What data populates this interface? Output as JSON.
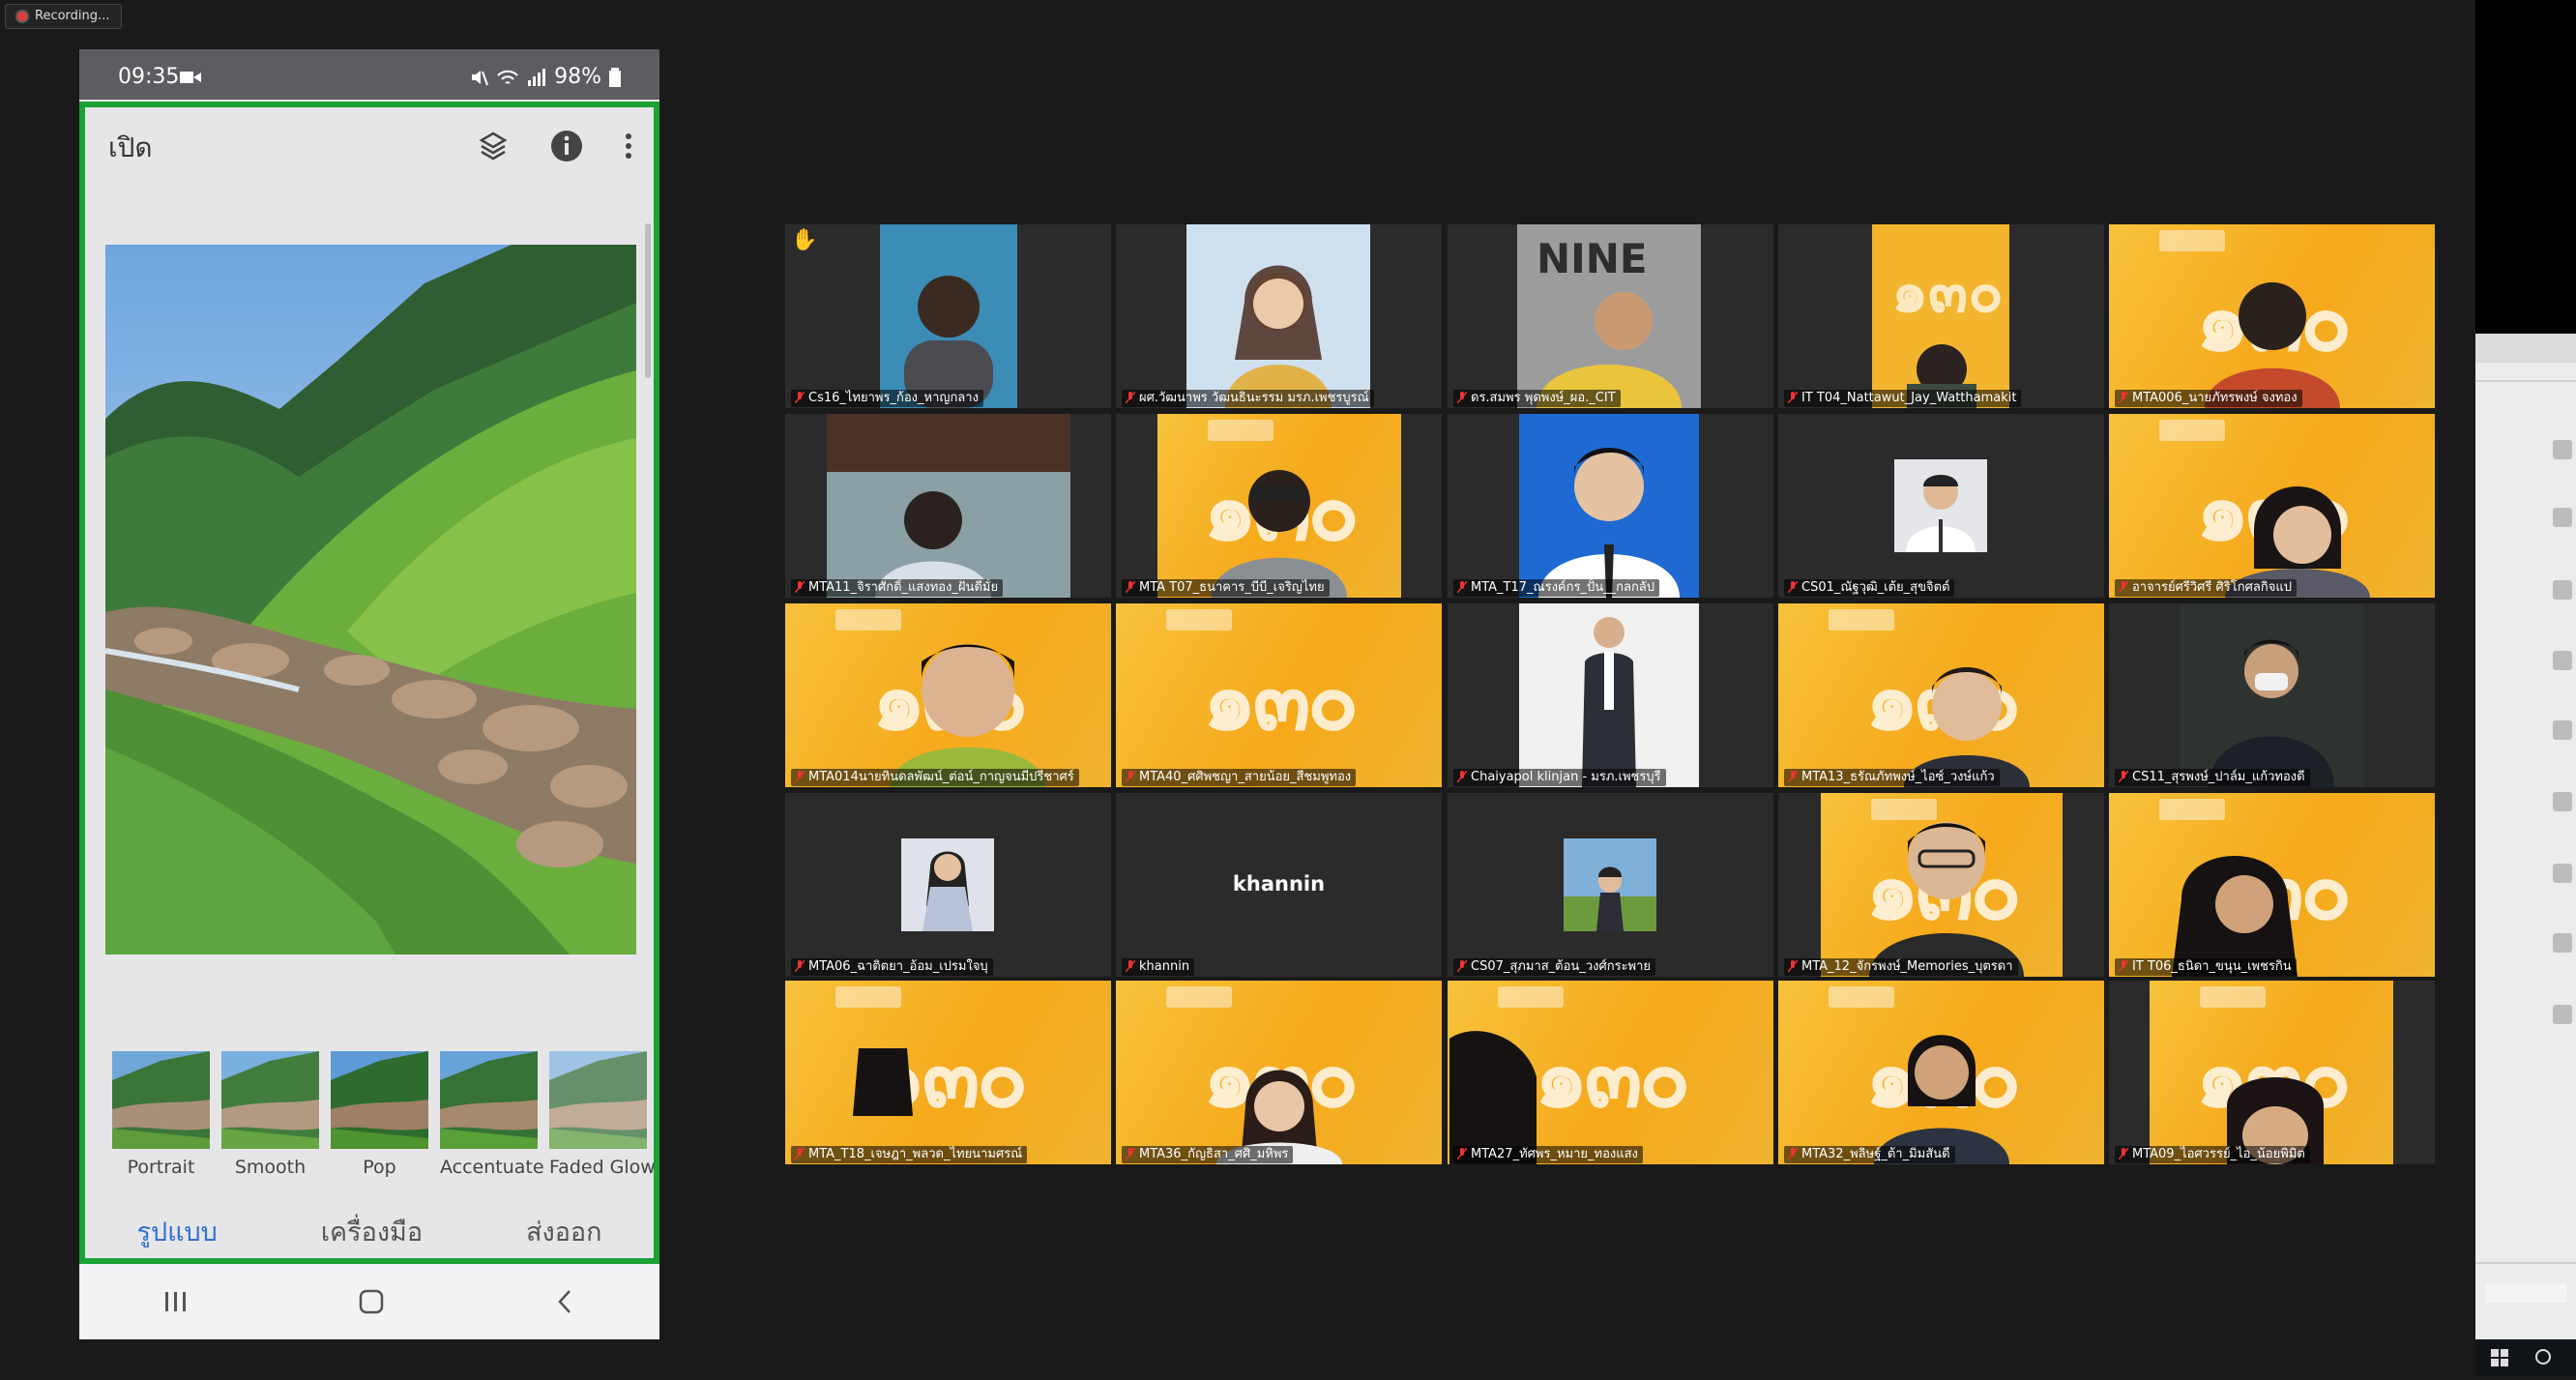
{
  "recording": {
    "label": "Recording..."
  },
  "phone": {
    "status": {
      "time": "09:35",
      "battery": "98%"
    },
    "header": {
      "open_label": "เปิด"
    },
    "filters": [
      {
        "label": "Portrait"
      },
      {
        "label": "Smooth"
      },
      {
        "label": "Pop"
      },
      {
        "label": "Accentuate"
      },
      {
        "label": "Faded Glow"
      }
    ],
    "tabs": {
      "styles": "รูปแบบ",
      "tools": "เครื่องมือ",
      "export": "ส่งออก"
    }
  },
  "meeting": {
    "participants": [
      {
        "name": "Cs16_ไทยาพร_ก้อง_หาญกลาง"
      },
      {
        "name": "ผศ.วัฒนาพร วัฒนธินะรรม มรภ.เพชรบูรณ์"
      },
      {
        "name": "ดร.สมพร พุดพงษ์_ผอ._CIT"
      },
      {
        "name": "IT T04_Nattawut_Jay_Watthamakit"
      },
      {
        "name": "MTA006_นายภัทรพงษ์ จงทอง"
      },
      {
        "name": "MTA11_จิราศักดิ์_แสงทอง_ฝันดีมั้ย"
      },
      {
        "name": "MTA T07_ธนาคาร_บีบี_เจริญไทย"
      },
      {
        "name": "MTA_T17_ณรงค์กร_ปั้น__กลกลัป"
      },
      {
        "name": "CS01_ณัฐวุฒิ_เต้ย_สุขจิตต์"
      },
      {
        "name": "อาจารย์ศรีวิศรี ศิริโกศลกิจแป"
      },
      {
        "name": "MTA014นายทินดลพัฒน์_ต่อน์_กาญจนมีปรีชาศร์"
      },
      {
        "name": "MTA40_ศศิพชญา_สายน้อย_สีชมพูทอง"
      },
      {
        "name": "Chaiyapol klinjan - มรภ.เพชรบุรี"
      },
      {
        "name": "MTA13_ธรัณภัทพงษ์_ไอซ์_วงษ์แก้ว"
      },
      {
        "name": "CS11_สุรพงษ์_ปาล์ม_แก้วทองดี"
      },
      {
        "name": "MTA06_ฉาติตยา_อ้อม_เปรมใจบุ"
      },
      {
        "name": "khannin"
      },
      {
        "name": "CS07_สุภมาส_ต้อน_วงศ์กระพาย"
      },
      {
        "name": "MTA_12_จักรพงษ์_Memories_บุตรดา"
      },
      {
        "name": "IT T06_ธนิดา_ขนุน_เพชรกิน"
      },
      {
        "name": "MTA_T18_เจษฎา_พลวด_ไทยนามศรณ์"
      },
      {
        "name": "MTA36_กัญธิสา_ศศิ_มหิพร"
      },
      {
        "name": "MTA27_ทัศพร_หมาย_ทองแสง"
      },
      {
        "name": "MTA32_พลิษฐ์_ต้า_มิ่มสันดี"
      },
      {
        "name": "MTA09_ไอศวรรย์_ไอ_น้อยพิมิต"
      }
    ],
    "center_labels": {
      "khannin": "khannin"
    },
    "accent": "#d7e44a"
  }
}
